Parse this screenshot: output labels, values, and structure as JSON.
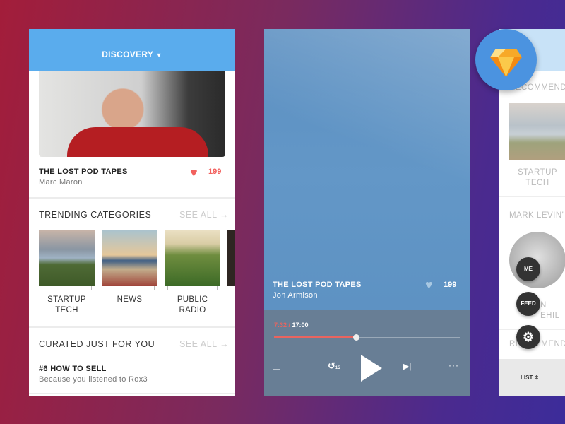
{
  "discovery": {
    "header": "DISCOVERY",
    "featured": {
      "title": "THE LOST POD TAPES",
      "author": "Marc Maron",
      "likes": "199"
    },
    "trending": {
      "title": "TRENDING CATEGORIES",
      "see_all": "SEE ALL",
      "categories": [
        {
          "line1": "STARTUP",
          "line2": "TECH"
        },
        {
          "line1": "NEWS",
          "line2": ""
        },
        {
          "line1": "PUBLIC",
          "line2": "RADIO"
        }
      ]
    },
    "curated": {
      "title": "CURATED JUST FOR YOU",
      "see_all": "SEE ALL",
      "items": [
        {
          "title": "#6 HOW TO SELL",
          "reason": "Because you listened to Rox3"
        }
      ]
    }
  },
  "player": {
    "title": "THE LOST POD TAPES",
    "author": "Jon Armison",
    "likes": "199",
    "elapsed": "7:32",
    "separator": " / ",
    "duration": "17:00",
    "progress_percent": 44,
    "skip_back_seconds": "15"
  },
  "third": {
    "section1": "RECOMMEND",
    "category": {
      "line1": "STARTUP",
      "line2": "TECH"
    },
    "section2": "MARK LEVIN'",
    "person_partial1": "N",
    "person_partial2": "EHIL",
    "section3": "RECOMMEND",
    "list_label": "LIST",
    "fab": {
      "me": "ME",
      "feed": "FEED"
    }
  },
  "colors": {
    "accent_blue": "#5aaced",
    "heart": "#f2615e",
    "progress": "#e9645f"
  }
}
